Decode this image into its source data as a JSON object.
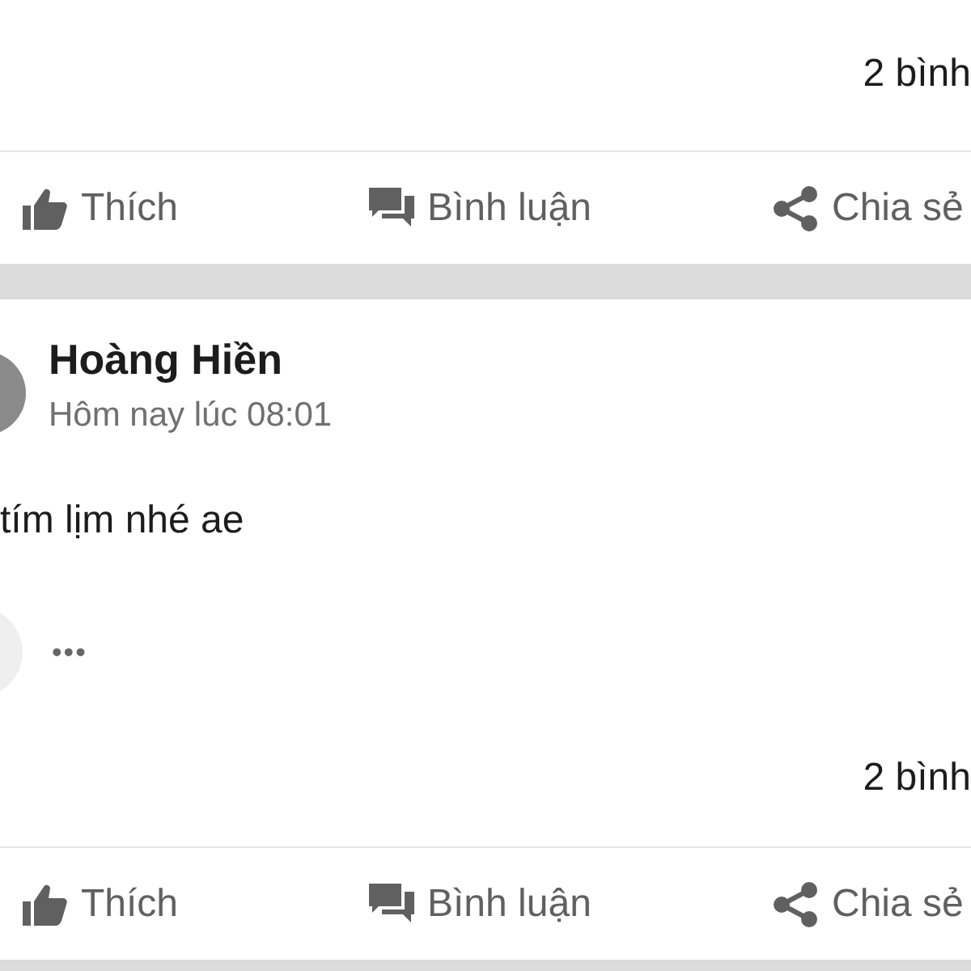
{
  "posts": [
    {
      "comment_count": "2 bình",
      "actions": [
        {
          "kind": "like",
          "label": "Thích"
        },
        {
          "kind": "comment",
          "label": "Bình luận"
        },
        {
          "kind": "share",
          "label": "Chia sẻ"
        }
      ]
    },
    {
      "author": "Hoàng Hiền",
      "time": "Hôm nay lúc 08:01",
      "text": "tím lịm nhé ae",
      "reply_more": "•••",
      "comment_count": "2 bình",
      "actions": [
        {
          "kind": "like",
          "label": "Thích"
        },
        {
          "kind": "comment",
          "label": "Bình luận"
        },
        {
          "kind": "share",
          "label": "Chia sẻ"
        }
      ]
    }
  ]
}
